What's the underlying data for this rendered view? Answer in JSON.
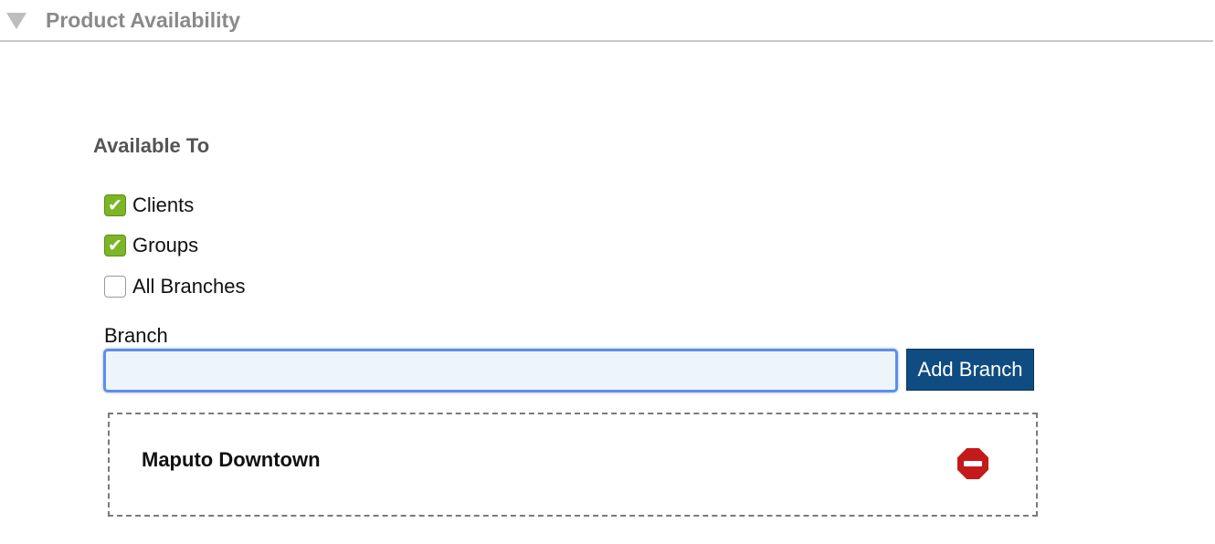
{
  "section": {
    "title": "Product Availability",
    "collapse_icon": "triangle-down-icon"
  },
  "available_to": {
    "label": "Available To",
    "options": [
      {
        "label": "Clients",
        "checked": true
      },
      {
        "label": "Groups",
        "checked": true
      },
      {
        "label": "All Branches",
        "checked": false
      }
    ]
  },
  "branch": {
    "label": "Branch",
    "input_value": "",
    "input_placeholder": "",
    "add_button_label": "Add Branch",
    "selected": [
      {
        "name": "Maputo Downtown",
        "remove_icon": "remove-circle-icon"
      }
    ]
  },
  "colors": {
    "checkbox_checked": "#7cb526",
    "button_bg": "#0f4c82",
    "input_border_focus": "#5d8fe8",
    "remove_icon": "#c41a1a"
  }
}
